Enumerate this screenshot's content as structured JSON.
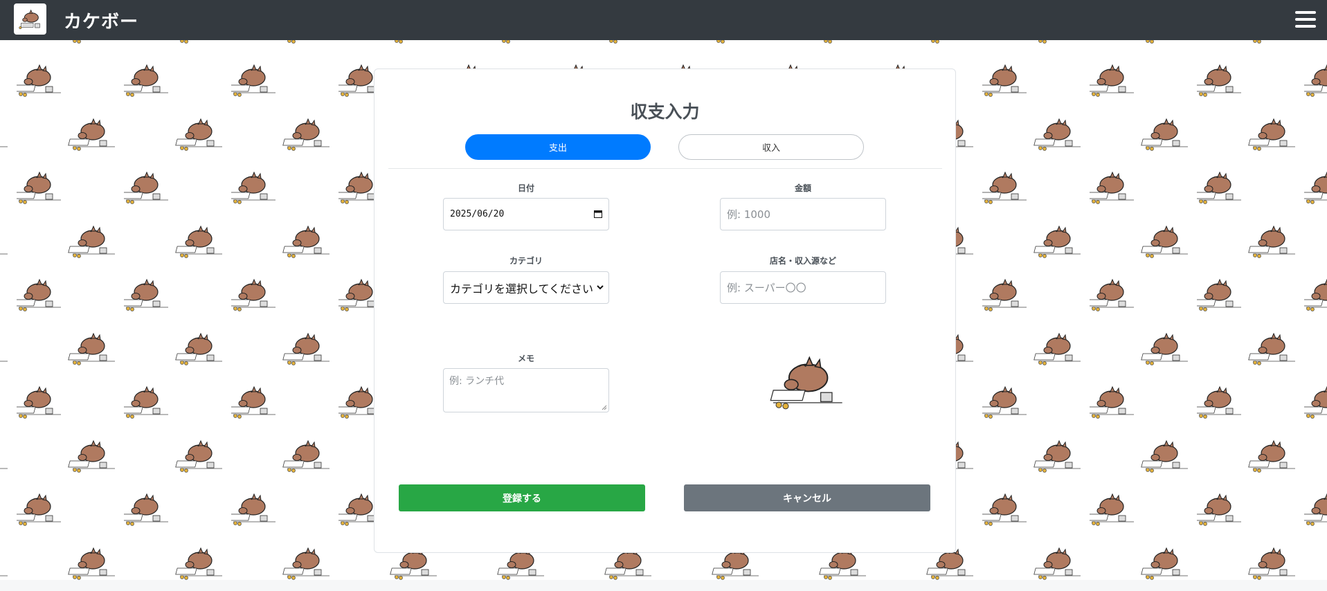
{
  "header": {
    "brand": "カケボー",
    "logo_icon": "boar-mascot-icon",
    "menu_icon": "hamburger-menu-icon",
    "bg_color": "#343a40"
  },
  "form": {
    "title": "収支入力",
    "tabs": [
      {
        "label": "支出",
        "active": true
      },
      {
        "label": "収入",
        "active": false
      }
    ],
    "date": {
      "label": "日付",
      "value": "2025/06/20"
    },
    "amount": {
      "label": "金額",
      "placeholder": "例: 1000"
    },
    "category": {
      "label": "カテゴリ",
      "selected": "カテゴリを選択してください"
    },
    "store": {
      "label": "店名・収入源など",
      "placeholder": "例: スーパー〇〇"
    },
    "memo": {
      "label": "メモ",
      "placeholder": "例: ランチ代"
    },
    "submit_label": "登録する",
    "cancel_label": "キャンセル"
  },
  "colors": {
    "primary": "#007bff",
    "success": "#28a745",
    "secondary": "#6c757d"
  }
}
